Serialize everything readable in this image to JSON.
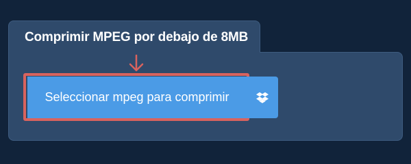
{
  "panel": {
    "title": "Comprimir MPEG por debajo de 8MB"
  },
  "upload": {
    "select_label": "Seleccionar mpeg para comprimir",
    "dropbox_icon": "dropbox-icon",
    "pointer_icon": "arrow-down-icon"
  },
  "colors": {
    "background": "#11233a",
    "panel": "#2f4a6b",
    "button": "#4b9be6",
    "highlight": "#d9635e"
  }
}
